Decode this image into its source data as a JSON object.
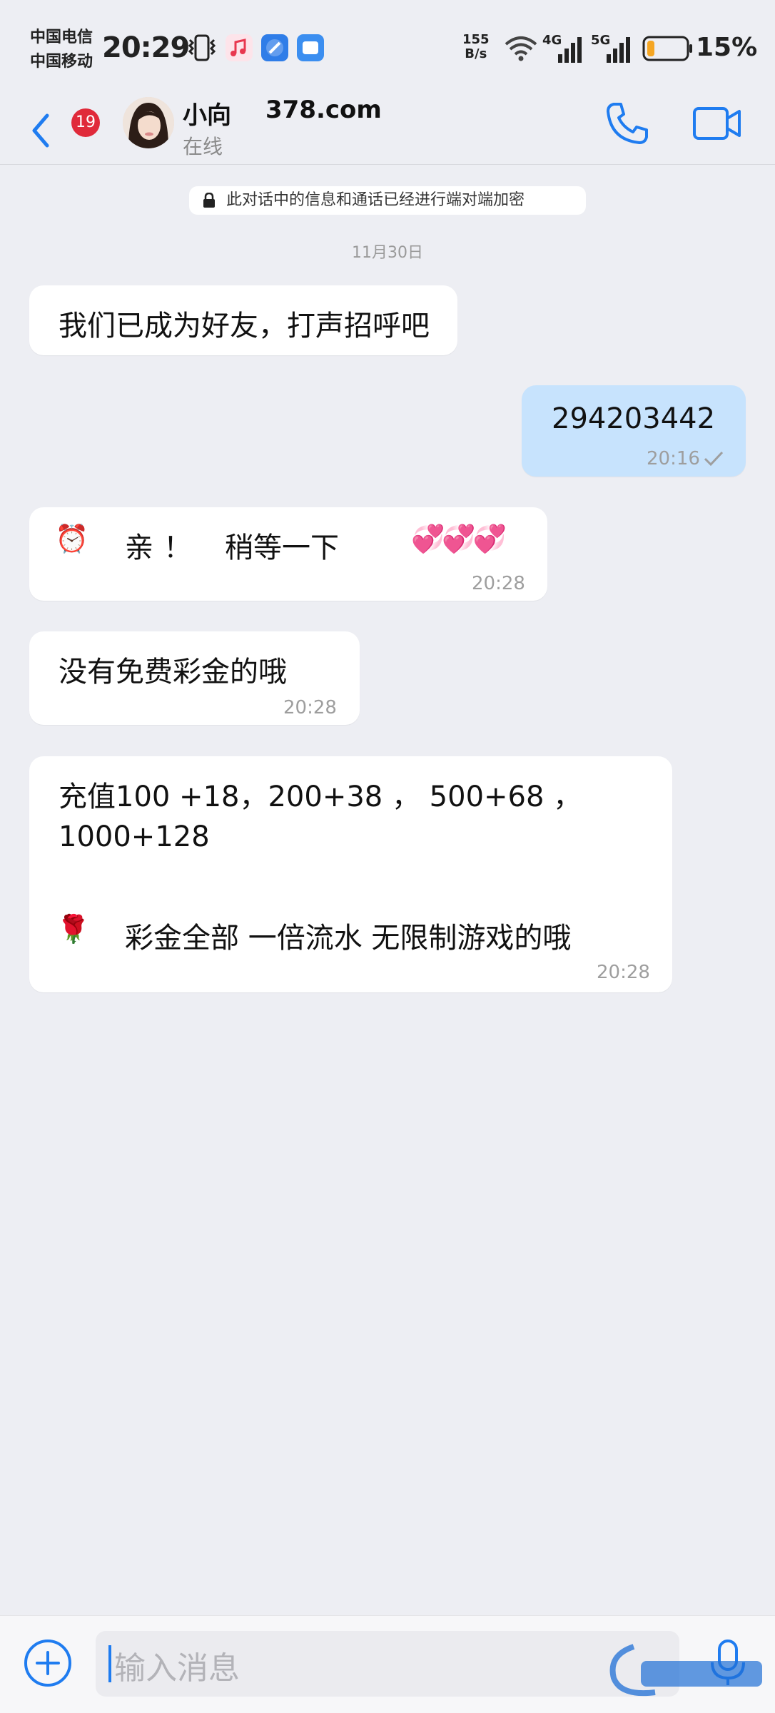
{
  "status_bar": {
    "carrier_1": "中国电信",
    "carrier_2": "中国移动",
    "time": "20:29",
    "net_speed_value": "155",
    "net_speed_unit": "B/s",
    "signal_1": "4G",
    "signal_2": "5G",
    "battery_percent": "15%",
    "battery_level": 0.15
  },
  "header": {
    "unread_count": "19",
    "contact_name": "小向",
    "contact_site": "378.com",
    "contact_status": "在线"
  },
  "notice": {
    "e2e": "此对话中的信息和通话已经进行端对端加密",
    "date": "11月30日"
  },
  "messages": [
    {
      "direction": "in",
      "text": "我们已成为好友，打声招呼吧"
    },
    {
      "direction": "out",
      "text": "294203442",
      "time": "20:16",
      "status": "read"
    },
    {
      "direction": "in",
      "text_1": "亲！",
      "text_2": "稍等一下",
      "emoji": "⏰",
      "hearts": "💞💞💞",
      "time": "20:28"
    },
    {
      "direction": "in",
      "text": "没有免费彩金的哦",
      "time": "20:28"
    },
    {
      "direction": "in",
      "line_1": "充值100 +18，200+38 ， 500+68 ，",
      "line_2": "1000+128",
      "line_3": "彩金全部 一倍流水 无限制游戏的哦",
      "emoji": "🌹",
      "time": "20:28"
    }
  ],
  "input": {
    "placeholder": "输入消息"
  },
  "colors": {
    "accent": "#1f7cf0",
    "badge": "#e02a3a",
    "outgoing_bubble": "#c7e3fd",
    "background": "#edeef3"
  },
  "icons": {
    "back": "chevron-left-icon",
    "call": "phone-icon",
    "video": "video-camera-icon",
    "attach": "plus-circle-icon",
    "mic": "microphone-icon",
    "lock": "lock-icon"
  }
}
